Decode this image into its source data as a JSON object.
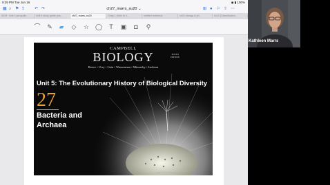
{
  "status_bar": {
    "time": "9:29 PM",
    "date": "Tue Jun 16",
    "battery": "100%"
  },
  "window": {
    "title": "ch27_marrs_su20"
  },
  "tabs": [
    {
      "label": "MCB ~Unit 2 ppt guide..."
    },
    {
      "label": "Unit 5 study guide pos..."
    },
    {
      "label": "ch27_marrs_su20"
    },
    {
      "label": "Chap 1 (Intro to li..."
    },
    {
      "label": "untitled notebook"
    },
    {
      "label": "ch26 biology & ph..."
    },
    {
      "label": "ch23 (Classification..."
    }
  ],
  "slide": {
    "campbell": "CAMPBELL",
    "biology": "BIOLOGY",
    "edition_line1": "TENTH",
    "edition_line2": "EDITION",
    "authors": "Reece • Urry • Cain • Wasserman • Minorsky • Jackson",
    "unit_title": "Unit 5: The Evolutionary History of Biological Diversity",
    "chapter_number": "27",
    "chapter_title_line1": "Bacteria and",
    "chapter_title_line2": "Archaea",
    "copyright": "© 2014 Pearson Education, Inc."
  },
  "participant": {
    "name": "Kathleen Marrs"
  },
  "colors": {
    "accent": "#2f6fd6",
    "chapter_orange": "#e8a13a",
    "highlighter": "#5fa8e6"
  }
}
